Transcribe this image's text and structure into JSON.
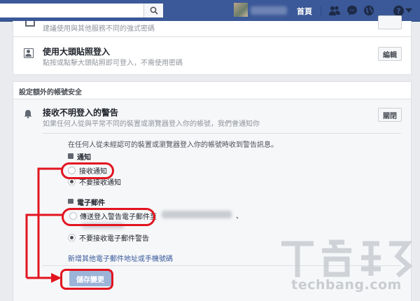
{
  "topbar": {
    "home_label": "首頁",
    "icons": [
      "search-icon",
      "friends-icon",
      "messenger-icon",
      "globe-icon",
      "help-icon",
      "dropdown-icon"
    ]
  },
  "rows": {
    "prev_desc": "建議使用與其他服務不同的強式密碼",
    "photo_login": {
      "title": "使用大頭貼照登入",
      "desc": "點按或點擊大頭貼照即可登入，不需使用密碼",
      "edit_label": "編輯"
    }
  },
  "extra_security": {
    "heading": "設定額外的帳號安全",
    "alerts": {
      "title": "接收不明登入的警告",
      "desc": "如果任何人從與平常不同的裝置或瀏覽器登入你的帳號，我們會通知你",
      "close_label": "關閉",
      "intro": "在任何人從未經認可的裝置或瀏覽器登入你的帳號時收到警告訊息。",
      "notifications": {
        "heading": "通知",
        "options": [
          "接收通知",
          "不要接收通知"
        ]
      },
      "email": {
        "heading": "電子郵件",
        "options": [
          "傳送登入警告電子郵件至",
          "不要接收電子郵件警告"
        ],
        "option1_suffix": "、"
      },
      "add_link": "新增其他電子郵件地址或手機號碼",
      "save_label": "儲存變更"
    }
  },
  "watermark": {
    "logo_text": "T客邦",
    "url": "techbang.com"
  },
  "colors": {
    "brand": "#3b5998",
    "highlight": "#e2151f",
    "link": "#365899"
  }
}
